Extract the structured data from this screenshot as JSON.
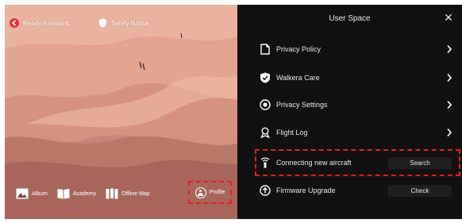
{
  "top_bar": {
    "back_label": "Ready Assistant",
    "tip_label": "Safety Notice"
  },
  "bottom_nav": {
    "items": [
      {
        "label": "Album",
        "icon": "image-icon"
      },
      {
        "label": "Academy",
        "icon": "book-icon"
      },
      {
        "label": "Offline Map",
        "icon": "map-icon"
      }
    ],
    "profile_label": "Profile",
    "profile_icon": "avatar-icon"
  },
  "panel": {
    "title": "User Space",
    "close_icon": "close-icon",
    "rows": [
      {
        "label": "Privacy Policy",
        "icon": "document-icon"
      },
      {
        "label": "Walkera Care",
        "icon": "shield-check-icon"
      },
      {
        "label": "Privacy Settings",
        "icon": "privacy-eye-icon"
      },
      {
        "label": "Flight Log",
        "icon": "flight-log-icon"
      }
    ],
    "connect": {
      "label": "Connecting new aircraft",
      "button": "Search",
      "icon": "aircraft-signal-icon"
    },
    "firmware": {
      "label": "Firmware Upgrade",
      "button": "Check",
      "icon": "upgrade-icon"
    }
  },
  "colors": {
    "highlight": "#e52020",
    "panel_bg": "#111111",
    "button_bg": "#1f1f1f",
    "back_icon": "#e6323c"
  }
}
